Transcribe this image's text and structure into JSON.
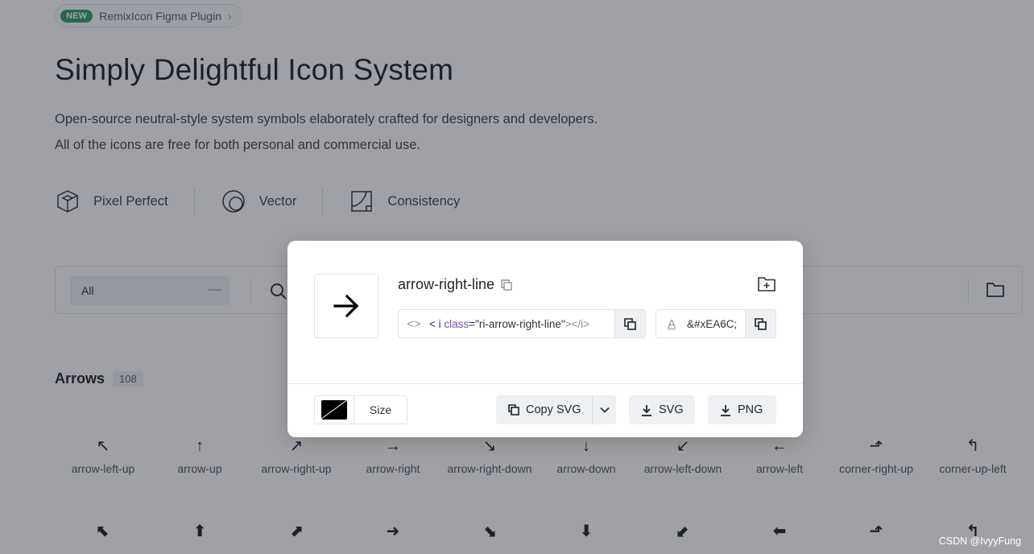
{
  "badge": {
    "tag": "NEW",
    "label": "RemixIcon Figma Plugin",
    "chevron": "›"
  },
  "hero": {
    "title": "Simply Delightful Icon System",
    "subtitle_line1": "Open-source neutral-style system symbols elaborately crafted for designers and developers.",
    "subtitle_line2": "All of the icons are free for both personal and commercial use."
  },
  "features": [
    {
      "icon": "cube-icon",
      "label": "Pixel Perfect"
    },
    {
      "icon": "vector-circle-icon",
      "label": "Vector"
    },
    {
      "icon": "grid-square-icon",
      "label": "Consistency"
    }
  ],
  "search": {
    "category_value": "All",
    "dropdown_glyph": "—"
  },
  "section": {
    "name": "Arrows",
    "count": "108"
  },
  "icons_row1": [
    {
      "glyph": "↖",
      "label": "arrow-left-up"
    },
    {
      "glyph": "↑",
      "label": "arrow-up"
    },
    {
      "glyph": "↗",
      "label": "arrow-right-up"
    },
    {
      "glyph": "→",
      "label": "arrow-right"
    },
    {
      "glyph": "↘",
      "label": "arrow-right-down"
    },
    {
      "glyph": "↓",
      "label": "arrow-down"
    },
    {
      "glyph": "↙",
      "label": "arrow-left-down"
    },
    {
      "glyph": "←",
      "label": "arrow-left"
    },
    {
      "glyph": "⬏",
      "label": "corner-right-up"
    },
    {
      "glyph": "↰",
      "label": "corner-up-left"
    }
  ],
  "icons_row2": [
    "⬉",
    "⬆",
    "⬈",
    "➜",
    "⬊",
    "⬇",
    "⬋",
    "⬅",
    "⬏",
    "↰"
  ],
  "modal": {
    "icon_name": "arrow-right-line",
    "code_open": "< i ",
    "code_attr": "class",
    "code_eq": "=",
    "code_value": "\"ri-arrow-right-line\"",
    "code_close": "></i>",
    "code_icon_glyph": "<>",
    "unicode_glyph": "A",
    "unicode_value": "&#xEA6C;",
    "size_label": "Size",
    "copy_svg_label": "Copy SVG",
    "svg_label": "SVG",
    "png_label": "PNG",
    "swatch_color": "#000000"
  },
  "watermark": "CSDN @IvyyFung"
}
